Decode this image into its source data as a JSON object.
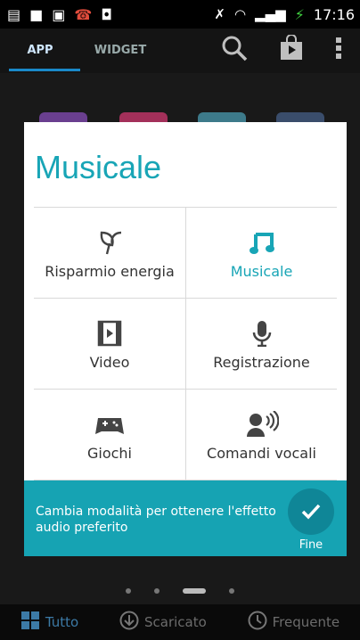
{
  "status_bar": {
    "time": "17:16",
    "icons": [
      "sd-card-icon",
      "notification-icon",
      "image-icon",
      "missed-call-icon",
      "shopping-bag-icon",
      "mute-icon",
      "wifi-icon",
      "signal-icon",
      "battery-charging-icon"
    ]
  },
  "top_tabs": {
    "items": [
      {
        "label": "APP",
        "active": true
      },
      {
        "label": "WIDGET",
        "active": false
      }
    ],
    "icons": [
      "search-icon",
      "play-store-icon",
      "overflow-menu-icon"
    ]
  },
  "dialog": {
    "title": "Musicale",
    "modes": [
      {
        "label": "Risparmio energia",
        "icon": "leaf-icon",
        "selected": false
      },
      {
        "label": "Musicale",
        "icon": "music-note-icon",
        "selected": true
      },
      {
        "label": "Video",
        "icon": "film-icon",
        "selected": false
      },
      {
        "label": "Registrazione",
        "icon": "microphone-icon",
        "selected": false
      },
      {
        "label": "Giochi",
        "icon": "gamepad-icon",
        "selected": false
      },
      {
        "label": "Comandi vocali",
        "icon": "voice-command-icon",
        "selected": false
      }
    ],
    "info_text": "Cambia modalità per ottenere l'effetto audio preferito",
    "done_label": "Fine"
  },
  "page_indicator": {
    "count": 4,
    "active_index": 2
  },
  "bottom_bar": {
    "items": [
      {
        "label": "Tutto",
        "icon": "grid-icon",
        "active": true
      },
      {
        "label": "Scaricato",
        "icon": "download-icon",
        "active": false
      },
      {
        "label": "Frequente",
        "icon": "clock-icon",
        "active": false
      }
    ]
  },
  "colors": {
    "accent": "#18a5b6",
    "info_bar": "#16a3b3",
    "tab_indicator": "#1a89c9"
  }
}
